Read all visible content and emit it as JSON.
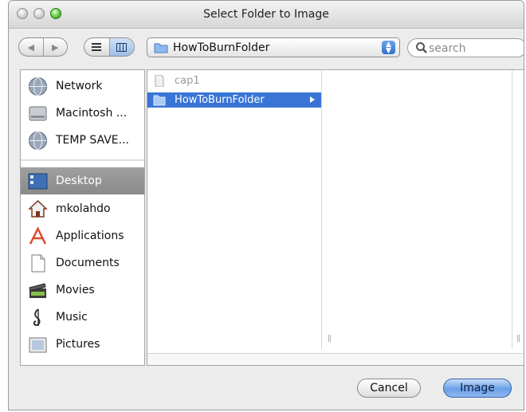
{
  "window": {
    "title": "Select Folder to Image"
  },
  "toolbar": {
    "back_icon": "back-arrow-icon",
    "forward_icon": "forward-arrow-icon",
    "list_view_icon": "list-view-icon",
    "column_view_icon": "column-view-icon",
    "location": "HowToBurnFolder",
    "search_placeholder": "search"
  },
  "sidebar": {
    "devices": [
      {
        "label": "Network",
        "icon": "network-globe-icon"
      },
      {
        "label": "Macintosh ...",
        "icon": "hard-drive-icon"
      },
      {
        "label": "TEMP SAVE...",
        "icon": "network-volume-icon"
      }
    ],
    "places": [
      {
        "label": "Desktop",
        "icon": "desktop-icon",
        "selected": true
      },
      {
        "label": "mkolahdo",
        "icon": "home-icon"
      },
      {
        "label": "Applications",
        "icon": "applications-icon"
      },
      {
        "label": "Documents",
        "icon": "documents-icon"
      },
      {
        "label": "Movies",
        "icon": "movies-clapper-icon"
      },
      {
        "label": "Music",
        "icon": "music-note-icon"
      },
      {
        "label": "Pictures",
        "icon": "pictures-icon"
      }
    ]
  },
  "browser": {
    "column1": [
      {
        "name": "cap1",
        "type": "file",
        "enabled": false
      },
      {
        "name": "HowToBurnFolder",
        "type": "folder",
        "selected": true
      }
    ]
  },
  "buttons": {
    "cancel": "Cancel",
    "confirm": "Image"
  },
  "colors": {
    "selection": "#3875d7",
    "sidebar_selected": "#8a8a8a"
  }
}
